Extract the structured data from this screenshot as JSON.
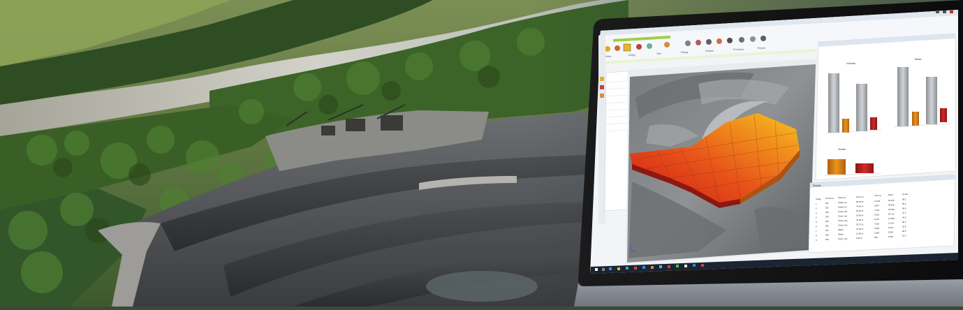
{
  "scene": {
    "description_icon": "quarry-aerial-photo",
    "colors": {
      "river": "#c9c7c4",
      "forest": "#3f6a2a",
      "rock": "#56585a",
      "bezel": "#111111",
      "accent_red": "#d42a1c",
      "accent_orange": "#f08a1c",
      "accent_yellow": "#f6c21a"
    }
  },
  "app": {
    "ribbon_groups": [
      "Define",
      "Design",
      "View",
      "Display",
      "Analysis",
      "Production",
      "Reports"
    ],
    "panel_right_top": "Volume",
    "panel_right_top2": "Mass",
    "panel_right_mid": "Grade",
    "panel_bottom_title": "Results",
    "table_headers": [
      "Stage",
      "Structure",
      "Material",
      "Percent",
      "Volume",
      "Mass",
      "Grade"
    ],
    "table_rows": [
      [
        "1",
        "201",
        "Grade_Fe",
        "82.48 %",
        "11,226",
        "30,312",
        "58.2"
      ],
      [
        "2",
        "202",
        "Grade_Fe",
        "74.81 %",
        "9,837",
        "26,560",
        "55.4"
      ],
      [
        "3",
        "203",
        "Fresh_Ore",
        "63.20 %",
        "7,442",
        "20,093",
        "49.6"
      ],
      [
        "4",
        "204",
        "Fresh_Ore",
        "51.66 %",
        "6,931",
        "18,714",
        "47.1"
      ],
      [
        "5",
        "205",
        "Oxide_Ore",
        "44.09 %",
        "5,207",
        "14,059",
        "44.9"
      ],
      [
        "6",
        "206",
        "Oxide_Ore",
        "33.72 %",
        "4,118",
        "11,119",
        "40.3"
      ],
      [
        "7",
        "207",
        "Waste",
        "21.55 %",
        "3,046",
        "8,224",
        "32.8"
      ],
      [
        "8",
        "208",
        "Waste",
        "12.90 %",
        "1,882",
        "5,081",
        "28.5"
      ],
      [
        "9",
        "209",
        "Fresh_Ore",
        "6.34 %",
        "946",
        "2,554",
        "22.0"
      ]
    ]
  }
}
